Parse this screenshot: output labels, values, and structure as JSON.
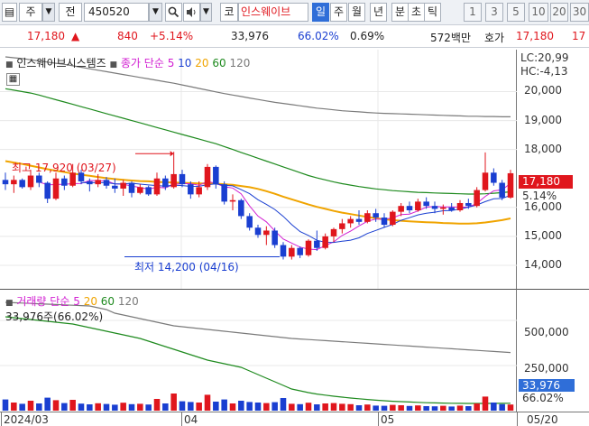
{
  "toolbar": {
    "market_label": "주",
    "pre_label": "전",
    "code": "450520",
    "kospi_label": "코",
    "stock_name": "인스웨이브",
    "periods": [
      "일",
      "주",
      "월",
      "년",
      "분",
      "초",
      "틱"
    ],
    "active_period": "일",
    "minute_options": [
      "1",
      "3",
      "5",
      "10",
      "20",
      "30"
    ]
  },
  "quote": {
    "price": "17,180",
    "arrow": "▲",
    "change": "840",
    "change_pct": "+5.14%",
    "volume": "33,976",
    "vol_ratio": "66.02%",
    "turnover": "0.69%",
    "amount": "572백만",
    "bid_label": "호가",
    "bid_price": "17,180",
    "bid_cut": "17"
  },
  "price_legend": {
    "name": "인스웨이브시스템즈",
    "type": "종가 단순",
    "ma": [
      "5",
      "10",
      "20",
      "60",
      "120"
    ]
  },
  "price_axis": {
    "lc": "LC:20,99",
    "hc": "HC:-4,13",
    "ticks": [
      "20,000",
      "19,000",
      "18,000",
      "16,000",
      "15,000",
      "14,000"
    ],
    "current": "17,180",
    "current_pct": "5.14%"
  },
  "annotations": {
    "high": "최고 17,920 (03/27)",
    "low": "최저 14,200 (04/16)"
  },
  "volume_legend": {
    "name": "거래량",
    "type": "단순",
    "ma": [
      "5",
      "20",
      "60",
      "120"
    ],
    "current": "33,976주(66.02%)"
  },
  "volume_axis": {
    "ticks": [
      "500,000",
      "250,000"
    ],
    "current": "33,976",
    "current_pct": "66.02%"
  },
  "dates": [
    "2024/03",
    "04",
    "05",
    "05/20"
  ],
  "colors": {
    "up": "#e0161d",
    "down": "#1a3fd1",
    "ma5": "#d21fd2",
    "ma10": "#1a3fd1",
    "ma20": "#f0a400",
    "ma60": "#1e8a1e",
    "ma120": "#7a7a7a",
    "active_tab": "#2f6ed8"
  },
  "chart_data": {
    "type": "candlestick",
    "price_range": [
      13500,
      21200
    ],
    "volume_range": [
      0,
      650000
    ],
    "candles": [
      {
        "o": 16950,
        "h": 17200,
        "l": 16600,
        "c": 16800
      },
      {
        "o": 16800,
        "h": 17100,
        "l": 16500,
        "c": 16950
      },
      {
        "o": 16950,
        "h": 17000,
        "l": 16650,
        "c": 16700
      },
      {
        "o": 16700,
        "h": 17300,
        "l": 16600,
        "c": 17100
      },
      {
        "o": 17100,
        "h": 17200,
        "l": 16700,
        "c": 16850
      },
      {
        "o": 16850,
        "h": 16900,
        "l": 16150,
        "c": 16300
      },
      {
        "o": 16300,
        "h": 17200,
        "l": 16250,
        "c": 17000
      },
      {
        "o": 17000,
        "h": 17100,
        "l": 16600,
        "c": 16750
      },
      {
        "o": 16750,
        "h": 17500,
        "l": 16700,
        "c": 17200
      },
      {
        "o": 17200,
        "h": 17300,
        "l": 16800,
        "c": 16900
      },
      {
        "o": 16900,
        "h": 17000,
        "l": 16550,
        "c": 16800
      },
      {
        "o": 16800,
        "h": 17150,
        "l": 16700,
        "c": 16950
      },
      {
        "o": 16950,
        "h": 17050,
        "l": 16650,
        "c": 16750
      },
      {
        "o": 16750,
        "h": 17000,
        "l": 16500,
        "c": 16650
      },
      {
        "o": 16650,
        "h": 16950,
        "l": 16400,
        "c": 16850
      },
      {
        "o": 16850,
        "h": 16900,
        "l": 16350,
        "c": 16500
      },
      {
        "o": 16500,
        "h": 16800,
        "l": 16450,
        "c": 16700
      },
      {
        "o": 16700,
        "h": 16750,
        "l": 16400,
        "c": 16450
      },
      {
        "o": 16450,
        "h": 17200,
        "l": 16400,
        "c": 17000
      },
      {
        "o": 17000,
        "h": 17100,
        "l": 16600,
        "c": 16700
      },
      {
        "o": 16700,
        "h": 17920,
        "l": 16650,
        "c": 17150
      },
      {
        "o": 17150,
        "h": 17300,
        "l": 16700,
        "c": 16800
      },
      {
        "o": 16800,
        "h": 16900,
        "l": 16300,
        "c": 16450
      },
      {
        "o": 16450,
        "h": 16900,
        "l": 16350,
        "c": 16700
      },
      {
        "o": 16700,
        "h": 17500,
        "l": 16600,
        "c": 17400
      },
      {
        "o": 17400,
        "h": 17450,
        "l": 16650,
        "c": 16800
      },
      {
        "o": 16800,
        "h": 16900,
        "l": 16100,
        "c": 16200
      },
      {
        "o": 16200,
        "h": 16450,
        "l": 15900,
        "c": 16250
      },
      {
        "o": 16250,
        "h": 16300,
        "l": 15600,
        "c": 15700
      },
      {
        "o": 15700,
        "h": 15800,
        "l": 15200,
        "c": 15300
      },
      {
        "o": 15300,
        "h": 15400,
        "l": 14950,
        "c": 15050
      },
      {
        "o": 15050,
        "h": 15350,
        "l": 14700,
        "c": 15200
      },
      {
        "o": 15200,
        "h": 15300,
        "l": 14600,
        "c": 14700
      },
      {
        "o": 14700,
        "h": 14800,
        "l": 14200,
        "c": 14300
      },
      {
        "o": 14300,
        "h": 14700,
        "l": 14200,
        "c": 14600
      },
      {
        "o": 14600,
        "h": 14650,
        "l": 14250,
        "c": 14350
      },
      {
        "o": 14350,
        "h": 14900,
        "l": 14300,
        "c": 14850
      },
      {
        "o": 14850,
        "h": 15200,
        "l": 14500,
        "c": 14600
      },
      {
        "o": 14600,
        "h": 15100,
        "l": 14550,
        "c": 15000
      },
      {
        "o": 15000,
        "h": 15300,
        "l": 14800,
        "c": 15250
      },
      {
        "o": 15250,
        "h": 15600,
        "l": 15100,
        "c": 15450
      },
      {
        "o": 15450,
        "h": 15700,
        "l": 15300,
        "c": 15600
      },
      {
        "o": 15600,
        "h": 15900,
        "l": 15400,
        "c": 15500
      },
      {
        "o": 15500,
        "h": 15900,
        "l": 15450,
        "c": 15800
      },
      {
        "o": 15800,
        "h": 15950,
        "l": 15500,
        "c": 15650
      },
      {
        "o": 15650,
        "h": 15800,
        "l": 15300,
        "c": 15400
      },
      {
        "o": 15400,
        "h": 15900,
        "l": 15350,
        "c": 15850
      },
      {
        "o": 15850,
        "h": 16150,
        "l": 15700,
        "c": 16050
      },
      {
        "o": 16050,
        "h": 16200,
        "l": 15800,
        "c": 15900
      },
      {
        "o": 15900,
        "h": 16300,
        "l": 15850,
        "c": 16200
      },
      {
        "o": 16200,
        "h": 16350,
        "l": 15950,
        "c": 16050
      },
      {
        "o": 16050,
        "h": 16200,
        "l": 15800,
        "c": 15950
      },
      {
        "o": 15950,
        "h": 16100,
        "l": 15750,
        "c": 16000
      },
      {
        "o": 16000,
        "h": 16150,
        "l": 15850,
        "c": 15900
      },
      {
        "o": 15900,
        "h": 16250,
        "l": 15850,
        "c": 16150
      },
      {
        "o": 16150,
        "h": 16300,
        "l": 15950,
        "c": 16050
      },
      {
        "o": 16050,
        "h": 16700,
        "l": 16000,
        "c": 16600
      },
      {
        "o": 16600,
        "h": 17900,
        "l": 16550,
        "c": 17200
      },
      {
        "o": 17200,
        "h": 17350,
        "l": 16750,
        "c": 16850
      },
      {
        "o": 16850,
        "h": 16950,
        "l": 16250,
        "c": 16340
      },
      {
        "o": 16340,
        "h": 17300,
        "l": 16300,
        "c": 17180
      }
    ],
    "volume": [
      62000,
      45000,
      38000,
      55000,
      40000,
      72000,
      58000,
      42000,
      60000,
      39000,
      35000,
      41000,
      37000,
      33000,
      44000,
      36000,
      38000,
      34000,
      65000,
      40000,
      95000,
      52000,
      48000,
      45000,
      88000,
      50000,
      62000,
      40000,
      55000,
      48000,
      45000,
      42000,
      47000,
      70000,
      38000,
      36000,
      44000,
      35000,
      40000,
      42000,
      38000,
      36000,
      30000,
      34000,
      28000,
      27000,
      32000,
      30000,
      26000,
      29000,
      25000,
      24000,
      27000,
      23000,
      28000,
      25000,
      40000,
      78000,
      45000,
      36000,
      33976
    ],
    "ma": [
      {
        "name": "20",
        "values": [
          17600,
          17550,
          17500,
          17440,
          17380,
          17320,
          17270,
          17220,
          17170,
          17130,
          17090,
          17050,
          17010,
          16980,
          16950,
          16930,
          16910,
          16900,
          16880,
          16870,
          16860,
          16850,
          16840,
          16830,
          16830,
          16820,
          16800,
          16780,
          16740,
          16700,
          16640,
          16560,
          16470,
          16370,
          16280,
          16190,
          16100,
          16020,
          15950,
          15880,
          15820,
          15770,
          15720,
          15670,
          15630,
          15590,
          15560,
          15540,
          15520,
          15500,
          15490,
          15480,
          15460,
          15450,
          15440,
          15440,
          15450,
          15480,
          15520,
          15560,
          15620
        ]
      },
      {
        "name": "60",
        "values": [
          20100,
          20050,
          20000,
          19950,
          19880,
          19800,
          19720,
          19640,
          19560,
          19480,
          19400,
          19320,
          19240,
          19160,
          19080,
          19000,
          18920,
          18840,
          18760,
          18680,
          18600,
          18520,
          18440,
          18360,
          18280,
          18200,
          18100,
          18000,
          17900,
          17800,
          17700,
          17600,
          17500,
          17400,
          17300,
          17200,
          17100,
          17020,
          16950,
          16880,
          16820,
          16770,
          16720,
          16680,
          16640,
          16610,
          16580,
          16560,
          16540,
          16520,
          16510,
          16500,
          16490,
          16480,
          16470,
          16460,
          16460,
          16470,
          16490,
          16510,
          16540
        ]
      },
      {
        "name": "120",
        "values": [
          21200,
          21170,
          21140,
          21100,
          21060,
          21020,
          20980,
          20940,
          20890,
          20840,
          20790,
          20740,
          20690,
          20640,
          20590,
          20540,
          20490,
          20440,
          20390,
          20340,
          20290,
          20230,
          20170,
          20110,
          20050,
          19990,
          19930,
          19880,
          19830,
          19780,
          19730,
          19680,
          19630,
          19590,
          19550,
          19510,
          19470,
          19430,
          19400,
          19370,
          19340,
          19320,
          19300,
          19280,
          19260,
          19250,
          19240,
          19230,
          19220,
          19210,
          19200,
          19190,
          19180,
          19170,
          19160,
          19150,
          19150,
          19140,
          19140,
          19130,
          19130
        ]
      }
    ],
    "volume_ma": [
      {
        "name": "60",
        "values": [
          520000,
          515000,
          510000,
          505000,
          500000,
          495000,
          490000,
          485000,
          480000,
          470000,
          460000,
          450000,
          440000,
          430000,
          420000,
          410000,
          400000,
          385000,
          370000,
          355000,
          340000,
          325000,
          310000,
          295000,
          280000,
          270000,
          260000,
          250000,
          240000,
          220000,
          200000,
          180000,
          160000,
          140000,
          120000,
          110000,
          100000,
          92000,
          86000,
          80000,
          75000,
          70000,
          66000,
          62000,
          58000,
          55000,
          52000,
          50000,
          48000,
          46000,
          44000,
          43000,
          42000,
          41000,
          40500,
          40000,
          40000,
          40000,
          40500,
          40500,
          41000
        ]
      },
      {
        "name": "120",
        "values": [
          600000,
          598000,
          596000,
          594000,
          592000,
          590000,
          588000,
          586000,
          584000,
          582000,
          580000,
          570000,
          560000,
          540000,
          530000,
          520000,
          510000,
          500000,
          490000,
          480000,
          470000,
          465000,
          460000,
          455000,
          450000,
          445000,
          440000,
          435000,
          430000,
          425000,
          420000,
          415000,
          410000,
          405000,
          400000,
          397000,
          394000,
          391000,
          388000,
          385000,
          382000,
          379000,
          376000,
          373000,
          370000,
          367000,
          364000,
          361000,
          358000,
          355000,
          352000,
          349000,
          346000,
          343000,
          340000,
          337000,
          334000,
          331000,
          328000,
          325000,
          322000
        ]
      }
    ]
  }
}
